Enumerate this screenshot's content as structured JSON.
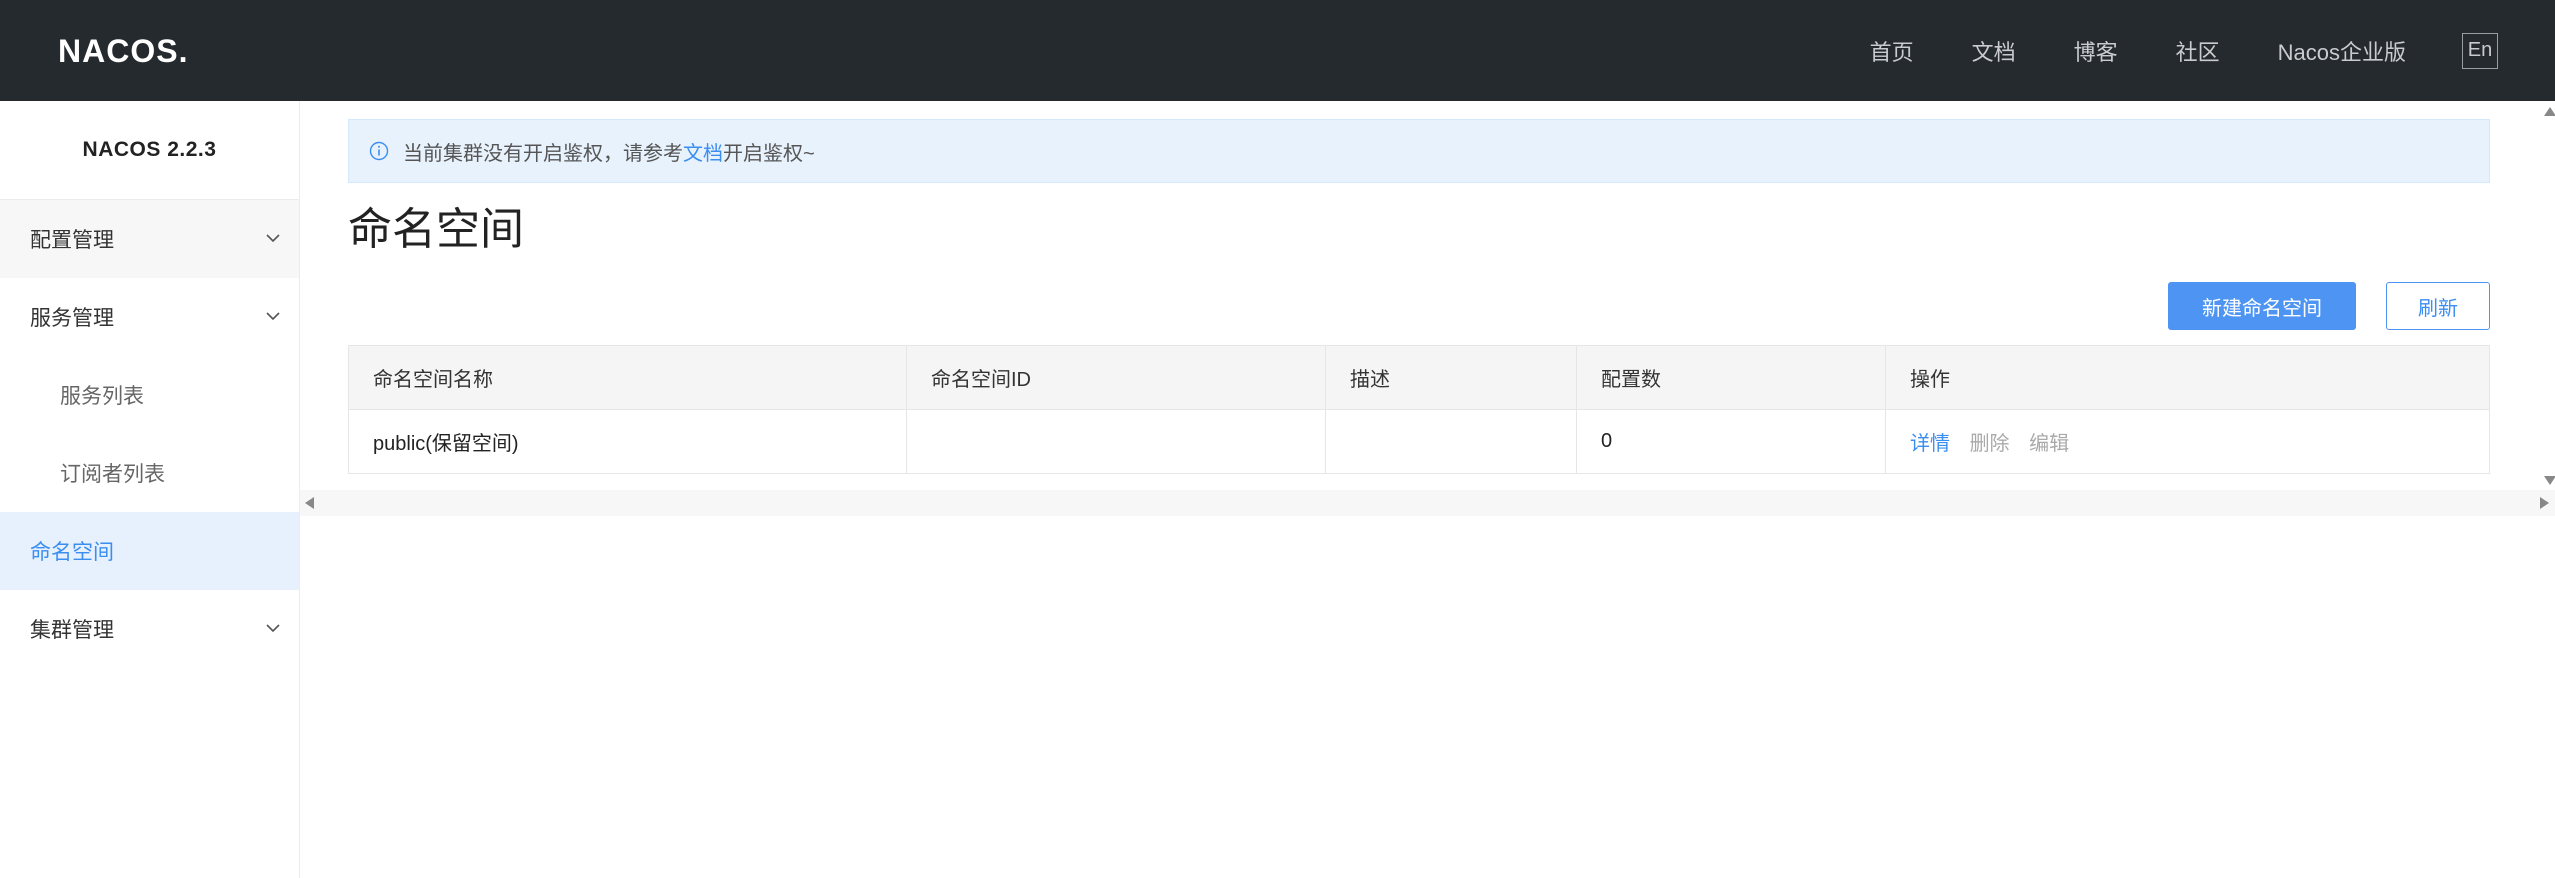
{
  "header": {
    "logo_text": "NACOS.",
    "nav": [
      "首页",
      "文档",
      "博客",
      "社区",
      "Nacos企业版"
    ],
    "lang_button": "En",
    "colors": {
      "background": "#252a2f",
      "text": "#c9cbcd"
    }
  },
  "sidebar": {
    "title": "NACOS 2.2.3",
    "items": [
      {
        "label": "配置管理",
        "type": "group",
        "icon": "chevron-down-icon"
      },
      {
        "label": "服务管理",
        "type": "group",
        "icon": "chevron-down-icon"
      },
      {
        "label": "服务列表",
        "type": "sub"
      },
      {
        "label": "订阅者列表",
        "type": "sub"
      },
      {
        "label": "命名空间",
        "type": "active"
      },
      {
        "label": "集群管理",
        "type": "group",
        "icon": "chevron-down-icon"
      }
    ]
  },
  "notice": {
    "prefix": "当前集群没有开启鉴权，请参考",
    "link": "文档",
    "suffix": "开启鉴权~",
    "icon": "info-icon"
  },
  "page": {
    "title": "命名空间",
    "new_button": "新建命名空间",
    "refresh_button": "刷新"
  },
  "table": {
    "columns": [
      "命名空间名称",
      "命名空间ID",
      "描述",
      "配置数",
      "操作"
    ],
    "rows": [
      {
        "name": "public(保留空间)",
        "id": "",
        "description": "",
        "config_count": "0",
        "actions": {
          "detail": "详情",
          "delete": "删除",
          "edit": "编辑"
        }
      }
    ]
  },
  "colors": {
    "accent": "#4d94f3",
    "link": "#3b8ef0",
    "active_bg": "#e6f1fd"
  }
}
